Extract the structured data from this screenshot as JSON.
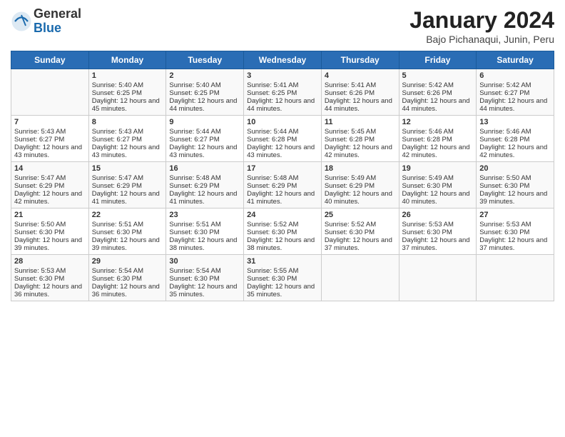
{
  "header": {
    "logo_general": "General",
    "logo_blue": "Blue",
    "month_title": "January 2024",
    "subtitle": "Bajo Pichanaqui, Junin, Peru"
  },
  "days_of_week": [
    "Sunday",
    "Monday",
    "Tuesday",
    "Wednesday",
    "Thursday",
    "Friday",
    "Saturday"
  ],
  "weeks": [
    [
      {
        "day": "",
        "sunrise": "",
        "sunset": "",
        "daylight": ""
      },
      {
        "day": "1",
        "sunrise": "Sunrise: 5:40 AM",
        "sunset": "Sunset: 6:25 PM",
        "daylight": "Daylight: 12 hours and 45 minutes."
      },
      {
        "day": "2",
        "sunrise": "Sunrise: 5:40 AM",
        "sunset": "Sunset: 6:25 PM",
        "daylight": "Daylight: 12 hours and 44 minutes."
      },
      {
        "day": "3",
        "sunrise": "Sunrise: 5:41 AM",
        "sunset": "Sunset: 6:25 PM",
        "daylight": "Daylight: 12 hours and 44 minutes."
      },
      {
        "day": "4",
        "sunrise": "Sunrise: 5:41 AM",
        "sunset": "Sunset: 6:26 PM",
        "daylight": "Daylight: 12 hours and 44 minutes."
      },
      {
        "day": "5",
        "sunrise": "Sunrise: 5:42 AM",
        "sunset": "Sunset: 6:26 PM",
        "daylight": "Daylight: 12 hours and 44 minutes."
      },
      {
        "day": "6",
        "sunrise": "Sunrise: 5:42 AM",
        "sunset": "Sunset: 6:27 PM",
        "daylight": "Daylight: 12 hours and 44 minutes."
      }
    ],
    [
      {
        "day": "7",
        "sunrise": "Sunrise: 5:43 AM",
        "sunset": "Sunset: 6:27 PM",
        "daylight": "Daylight: 12 hours and 43 minutes."
      },
      {
        "day": "8",
        "sunrise": "Sunrise: 5:43 AM",
        "sunset": "Sunset: 6:27 PM",
        "daylight": "Daylight: 12 hours and 43 minutes."
      },
      {
        "day": "9",
        "sunrise": "Sunrise: 5:44 AM",
        "sunset": "Sunset: 6:27 PM",
        "daylight": "Daylight: 12 hours and 43 minutes."
      },
      {
        "day": "10",
        "sunrise": "Sunrise: 5:44 AM",
        "sunset": "Sunset: 6:28 PM",
        "daylight": "Daylight: 12 hours and 43 minutes."
      },
      {
        "day": "11",
        "sunrise": "Sunrise: 5:45 AM",
        "sunset": "Sunset: 6:28 PM",
        "daylight": "Daylight: 12 hours and 42 minutes."
      },
      {
        "day": "12",
        "sunrise": "Sunrise: 5:46 AM",
        "sunset": "Sunset: 6:28 PM",
        "daylight": "Daylight: 12 hours and 42 minutes."
      },
      {
        "day": "13",
        "sunrise": "Sunrise: 5:46 AM",
        "sunset": "Sunset: 6:28 PM",
        "daylight": "Daylight: 12 hours and 42 minutes."
      }
    ],
    [
      {
        "day": "14",
        "sunrise": "Sunrise: 5:47 AM",
        "sunset": "Sunset: 6:29 PM",
        "daylight": "Daylight: 12 hours and 42 minutes."
      },
      {
        "day": "15",
        "sunrise": "Sunrise: 5:47 AM",
        "sunset": "Sunset: 6:29 PM",
        "daylight": "Daylight: 12 hours and 41 minutes."
      },
      {
        "day": "16",
        "sunrise": "Sunrise: 5:48 AM",
        "sunset": "Sunset: 6:29 PM",
        "daylight": "Daylight: 12 hours and 41 minutes."
      },
      {
        "day": "17",
        "sunrise": "Sunrise: 5:48 AM",
        "sunset": "Sunset: 6:29 PM",
        "daylight": "Daylight: 12 hours and 41 minutes."
      },
      {
        "day": "18",
        "sunrise": "Sunrise: 5:49 AM",
        "sunset": "Sunset: 6:29 PM",
        "daylight": "Daylight: 12 hours and 40 minutes."
      },
      {
        "day": "19",
        "sunrise": "Sunrise: 5:49 AM",
        "sunset": "Sunset: 6:30 PM",
        "daylight": "Daylight: 12 hours and 40 minutes."
      },
      {
        "day": "20",
        "sunrise": "Sunrise: 5:50 AM",
        "sunset": "Sunset: 6:30 PM",
        "daylight": "Daylight: 12 hours and 39 minutes."
      }
    ],
    [
      {
        "day": "21",
        "sunrise": "Sunrise: 5:50 AM",
        "sunset": "Sunset: 6:30 PM",
        "daylight": "Daylight: 12 hours and 39 minutes."
      },
      {
        "day": "22",
        "sunrise": "Sunrise: 5:51 AM",
        "sunset": "Sunset: 6:30 PM",
        "daylight": "Daylight: 12 hours and 39 minutes."
      },
      {
        "day": "23",
        "sunrise": "Sunrise: 5:51 AM",
        "sunset": "Sunset: 6:30 PM",
        "daylight": "Daylight: 12 hours and 38 minutes."
      },
      {
        "day": "24",
        "sunrise": "Sunrise: 5:52 AM",
        "sunset": "Sunset: 6:30 PM",
        "daylight": "Daylight: 12 hours and 38 minutes."
      },
      {
        "day": "25",
        "sunrise": "Sunrise: 5:52 AM",
        "sunset": "Sunset: 6:30 PM",
        "daylight": "Daylight: 12 hours and 37 minutes."
      },
      {
        "day": "26",
        "sunrise": "Sunrise: 5:53 AM",
        "sunset": "Sunset: 6:30 PM",
        "daylight": "Daylight: 12 hours and 37 minutes."
      },
      {
        "day": "27",
        "sunrise": "Sunrise: 5:53 AM",
        "sunset": "Sunset: 6:30 PM",
        "daylight": "Daylight: 12 hours and 37 minutes."
      }
    ],
    [
      {
        "day": "28",
        "sunrise": "Sunrise: 5:53 AM",
        "sunset": "Sunset: 6:30 PM",
        "daylight": "Daylight: 12 hours and 36 minutes."
      },
      {
        "day": "29",
        "sunrise": "Sunrise: 5:54 AM",
        "sunset": "Sunset: 6:30 PM",
        "daylight": "Daylight: 12 hours and 36 minutes."
      },
      {
        "day": "30",
        "sunrise": "Sunrise: 5:54 AM",
        "sunset": "Sunset: 6:30 PM",
        "daylight": "Daylight: 12 hours and 35 minutes."
      },
      {
        "day": "31",
        "sunrise": "Sunrise: 5:55 AM",
        "sunset": "Sunset: 6:30 PM",
        "daylight": "Daylight: 12 hours and 35 minutes."
      },
      {
        "day": "",
        "sunrise": "",
        "sunset": "",
        "daylight": ""
      },
      {
        "day": "",
        "sunrise": "",
        "sunset": "",
        "daylight": ""
      },
      {
        "day": "",
        "sunrise": "",
        "sunset": "",
        "daylight": ""
      }
    ]
  ]
}
